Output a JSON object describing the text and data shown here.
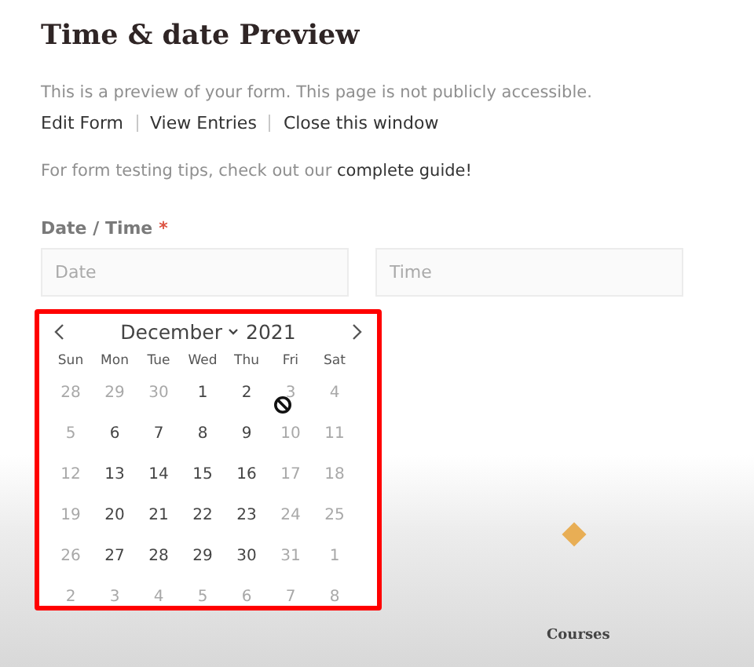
{
  "title": "Time & date Preview",
  "notice": "This is a preview of your form. This page is not publicly accessible.",
  "links": [
    "Edit Form",
    "View Entries",
    "Close this window"
  ],
  "tip": {
    "text": "For form testing tips, check out our",
    "link": "complete guide!"
  },
  "field_label": {
    "text": "Date / Time",
    "required_mark": "*"
  },
  "fields": [
    {
      "placeholder": "Date"
    },
    {
      "placeholder": "Time"
    }
  ],
  "calendar": {
    "month": "December",
    "year": "2021",
    "weekdays": [
      "Sun",
      "Mon",
      "Tue",
      "Wed",
      "Thu",
      "Fri",
      "Sat"
    ],
    "weeks": [
      [
        {
          "day": "28",
          "disabled": true
        },
        {
          "day": "29",
          "disabled": true
        },
        {
          "day": "30",
          "disabled": true
        },
        {
          "day": "1",
          "disabled": false
        },
        {
          "day": "2",
          "disabled": false
        },
        {
          "day": "3",
          "disabled": true
        },
        {
          "day": "4",
          "disabled": true
        }
      ],
      [
        {
          "day": "5",
          "disabled": true
        },
        {
          "day": "6",
          "disabled": false
        },
        {
          "day": "7",
          "disabled": false
        },
        {
          "day": "8",
          "disabled": false
        },
        {
          "day": "9",
          "disabled": false
        },
        {
          "day": "10",
          "disabled": true
        },
        {
          "day": "11",
          "disabled": true
        }
      ],
      [
        {
          "day": "12",
          "disabled": true
        },
        {
          "day": "13",
          "disabled": false
        },
        {
          "day": "14",
          "disabled": false
        },
        {
          "day": "15",
          "disabled": false
        },
        {
          "day": "16",
          "disabled": false
        },
        {
          "day": "17",
          "disabled": true
        },
        {
          "day": "18",
          "disabled": true
        }
      ],
      [
        {
          "day": "19",
          "disabled": true
        },
        {
          "day": "20",
          "disabled": false
        },
        {
          "day": "21",
          "disabled": false
        },
        {
          "day": "22",
          "disabled": false
        },
        {
          "day": "23",
          "disabled": false
        },
        {
          "day": "24",
          "disabled": true
        },
        {
          "day": "25",
          "disabled": true
        }
      ],
      [
        {
          "day": "26",
          "disabled": true
        },
        {
          "day": "27",
          "disabled": false
        },
        {
          "day": "28",
          "disabled": false
        },
        {
          "day": "29",
          "disabled": false
        },
        {
          "day": "30",
          "disabled": false
        },
        {
          "day": "31",
          "disabled": true
        },
        {
          "day": "1",
          "disabled": true
        }
      ],
      [
        {
          "day": "2",
          "disabled": true
        },
        {
          "day": "3",
          "disabled": true
        },
        {
          "day": "4",
          "disabled": true
        },
        {
          "day": "5",
          "disabled": true
        },
        {
          "day": "6",
          "disabled": true
        },
        {
          "day": "7",
          "disabled": true
        },
        {
          "day": "8",
          "disabled": true
        }
      ]
    ]
  },
  "footer_label": "Courses"
}
